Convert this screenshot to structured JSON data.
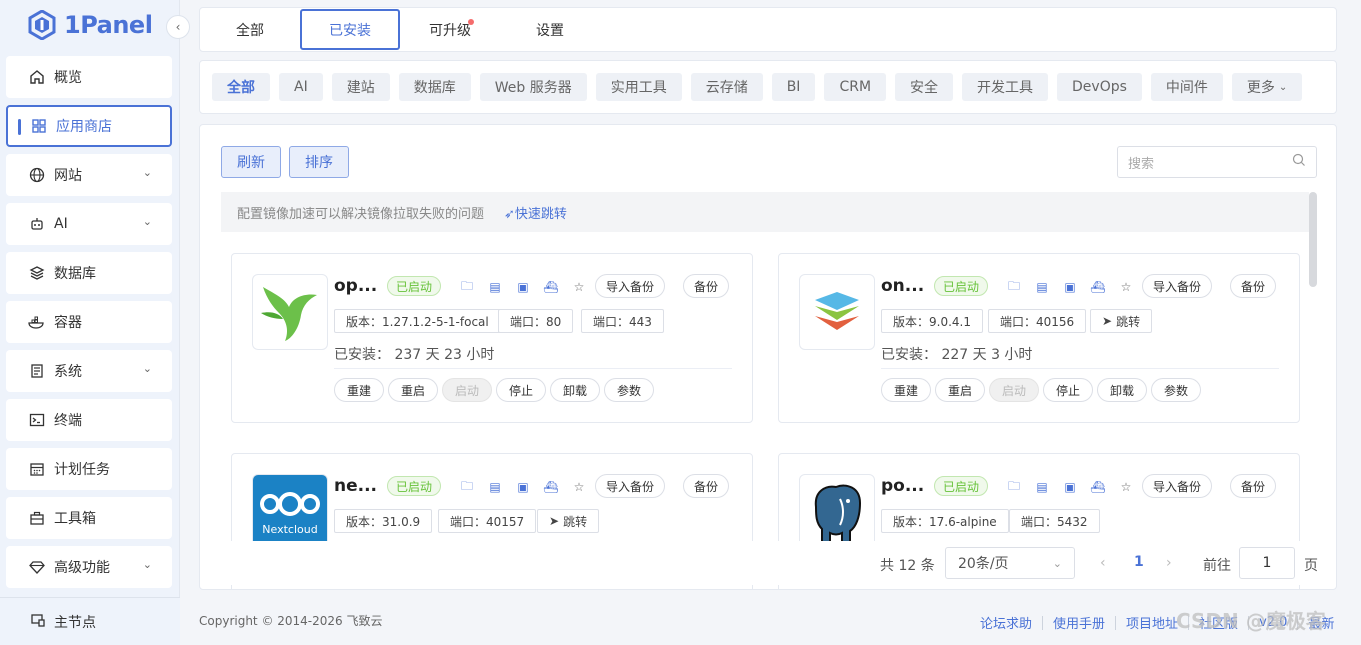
{
  "brand": {
    "name": "1Panel"
  },
  "sidebar": {
    "items": [
      {
        "label": "概览",
        "icon": "home-icon"
      },
      {
        "label": "应用商店",
        "icon": "grid-icon"
      },
      {
        "label": "网站",
        "icon": "globe-icon"
      },
      {
        "label": "AI",
        "icon": "robot-icon"
      },
      {
        "label": "数据库",
        "icon": "layers-icon"
      },
      {
        "label": "容器",
        "icon": "docker-icon"
      },
      {
        "label": "系统",
        "icon": "system-icon"
      },
      {
        "label": "终端",
        "icon": "terminal-icon"
      },
      {
        "label": "计划任务",
        "icon": "calendar-icon"
      },
      {
        "label": "工具箱",
        "icon": "toolbox-icon"
      },
      {
        "label": "高级功能",
        "icon": "diamond-icon"
      }
    ],
    "footer_node": "主节点"
  },
  "tabs": [
    "全部",
    "已安装",
    "可升级",
    "设置"
  ],
  "categories": [
    "全部",
    "AI",
    "建站",
    "数据库",
    "Web 服务器",
    "实用工具",
    "云存储",
    "BI",
    "CRM",
    "安全",
    "开发工具",
    "DevOps",
    "中间件",
    "更多"
  ],
  "toolbar": {
    "refresh": "刷新",
    "sort": "排序",
    "search_placeholder": "搜索"
  },
  "notice": {
    "text": "配置镜像加速可以解决镜像拉取失败的问题",
    "link": "快速跳转"
  },
  "common": {
    "status": "已启动",
    "import_backup": "导入备份",
    "backup": "备份",
    "installed_label": "已安装：",
    "jump": "跳转",
    "actions": [
      "重建",
      "重启",
      "启动",
      "停止",
      "卸载",
      "参数"
    ]
  },
  "apps": [
    {
      "name": "op...",
      "version": "版本：1.27.1.2-5-1-focal",
      "port1": "端口：80",
      "port2": "端口：443",
      "installed": "237 天 23 小时"
    },
    {
      "name": "on...",
      "version": "版本：9.0.4.1",
      "port1": "端口：40156",
      "installed": "227 天 3 小时"
    },
    {
      "name": "ne...",
      "version": "版本：31.0.9",
      "port1": "端口：40157",
      "logo_text": "Nextcloud"
    },
    {
      "name": "po...",
      "version": "版本：17.6-alpine",
      "port1": "端口：5432"
    }
  ],
  "pager": {
    "total": "共 12 条",
    "size": "20条/页",
    "current": "1",
    "goto": "前往",
    "jump_value": "1",
    "page_suffix": "页"
  },
  "footer": {
    "copyright": "Copyright © 2014-2026 飞致云",
    "links": [
      "论坛求助",
      "使用手册",
      "项目地址",
      "社区版",
      "v2.0",
      "最新"
    ],
    "watermark": "CSDN @魔极客"
  },
  "colors": {
    "accent": "#4a72d6",
    "status_green": "#67c23a",
    "dot_red": "#f56c6c"
  }
}
